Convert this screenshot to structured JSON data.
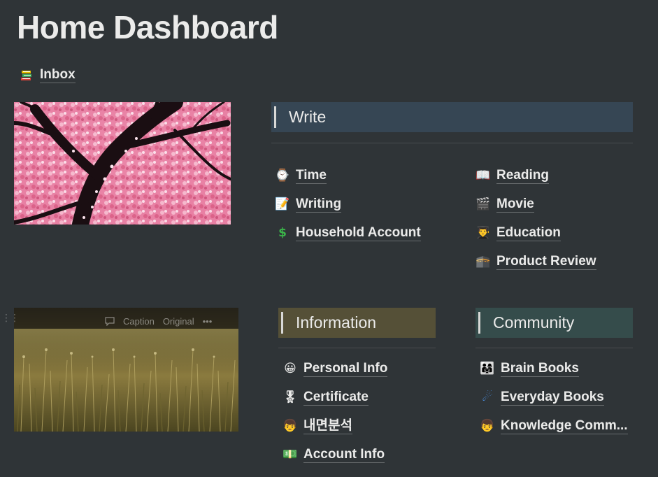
{
  "page": {
    "title": "Home Dashboard"
  },
  "inbox": {
    "label": "Inbox",
    "icon": "books-icon"
  },
  "images": {
    "blossom": {
      "icon": "cherry-blossom-image"
    },
    "field": {
      "toolbar": {
        "caption": "Caption",
        "original": "Original",
        "more": "•••"
      }
    }
  },
  "write": {
    "header": "Write",
    "col1": [
      {
        "label": "Time",
        "icon": "watch-icon",
        "glyph": "⌚"
      },
      {
        "label": "Writing",
        "icon": "memo-icon",
        "glyph": "📝"
      },
      {
        "label": "Household Account",
        "icon": "dollar-icon",
        "glyph": "$"
      }
    ],
    "col2": [
      {
        "label": "Reading",
        "icon": "open-book-icon",
        "glyph": "📖"
      },
      {
        "label": "Movie",
        "icon": "clapper-icon",
        "glyph": "🎬"
      },
      {
        "label": "Education",
        "icon": "student-icon",
        "glyph": "👨‍🎓"
      },
      {
        "label": "Product Review",
        "icon": "kaaba-icon",
        "glyph": "🕋"
      }
    ]
  },
  "information": {
    "header": "Information",
    "items": [
      {
        "label": "Personal Info",
        "icon": "grinning-face-icon",
        "glyph": "😀"
      },
      {
        "label": "Certificate",
        "icon": "medal-icon",
        "glyph": "🎖"
      },
      {
        "label": "내면분석",
        "icon": "boy-face-icon",
        "glyph": "👦"
      },
      {
        "label": "Account Info",
        "icon": "money-icon",
        "glyph": "💵"
      }
    ]
  },
  "community": {
    "header": "Community",
    "items": [
      {
        "label": "Brain Books",
        "icon": "family-icon",
        "glyph": "👨‍👩‍👧"
      },
      {
        "label": "Everyday Books",
        "icon": "comet-icon",
        "glyph": "☄"
      },
      {
        "label": "Knowledge Comm...",
        "icon": "boy-face-icon",
        "glyph": "👦"
      }
    ]
  },
  "colors": {
    "background": "#2f3437",
    "write_header": "#364654",
    "information_header": "#555037",
    "community_header": "#354c4b"
  }
}
